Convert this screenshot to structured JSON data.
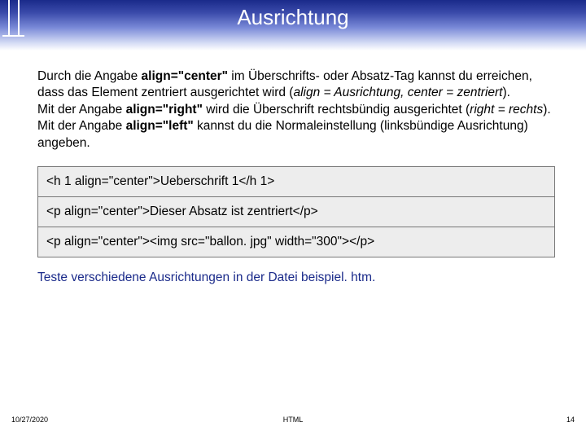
{
  "header": {
    "title": "Ausrichtung"
  },
  "para": {
    "p1a": "Durch die Angabe ",
    "p1b": "align=\"center\"",
    "p1c": " im Überschrifts- oder Absatz-Tag kannst du erreichen, dass das Element zentriert ausgerichtet wird (",
    "p1d": "align = Ausrichtung, center = zentriert",
    "p1e": ").",
    "p2a": "Mit der Angabe ",
    "p2b": "align=\"right\"",
    "p2c": " wird die Überschrift rechtsbündig ausgerichtet (",
    "p2d": "right = rechts",
    "p2e": ").",
    "p3a": "Mit der Angabe ",
    "p3b": "align=\"left\"",
    "p3c": " kannst du die Normaleinstellung (linksbündige Ausrichtung) angeben."
  },
  "code": {
    "line1": "<h 1 align=\"center\">Ueberschrift 1</h 1>",
    "line2": "<p align=\"center\">Dieser Absatz ist zentriert</p>",
    "line3": "<p align=\"center\"><img src=\"ballon. jpg\" width=\"300\"></p>"
  },
  "test": "Teste verschiedene Ausrichtungen in der Datei beispiel. htm.",
  "footer": {
    "date": "10/27/2020",
    "center": "HTML",
    "page": "14"
  }
}
